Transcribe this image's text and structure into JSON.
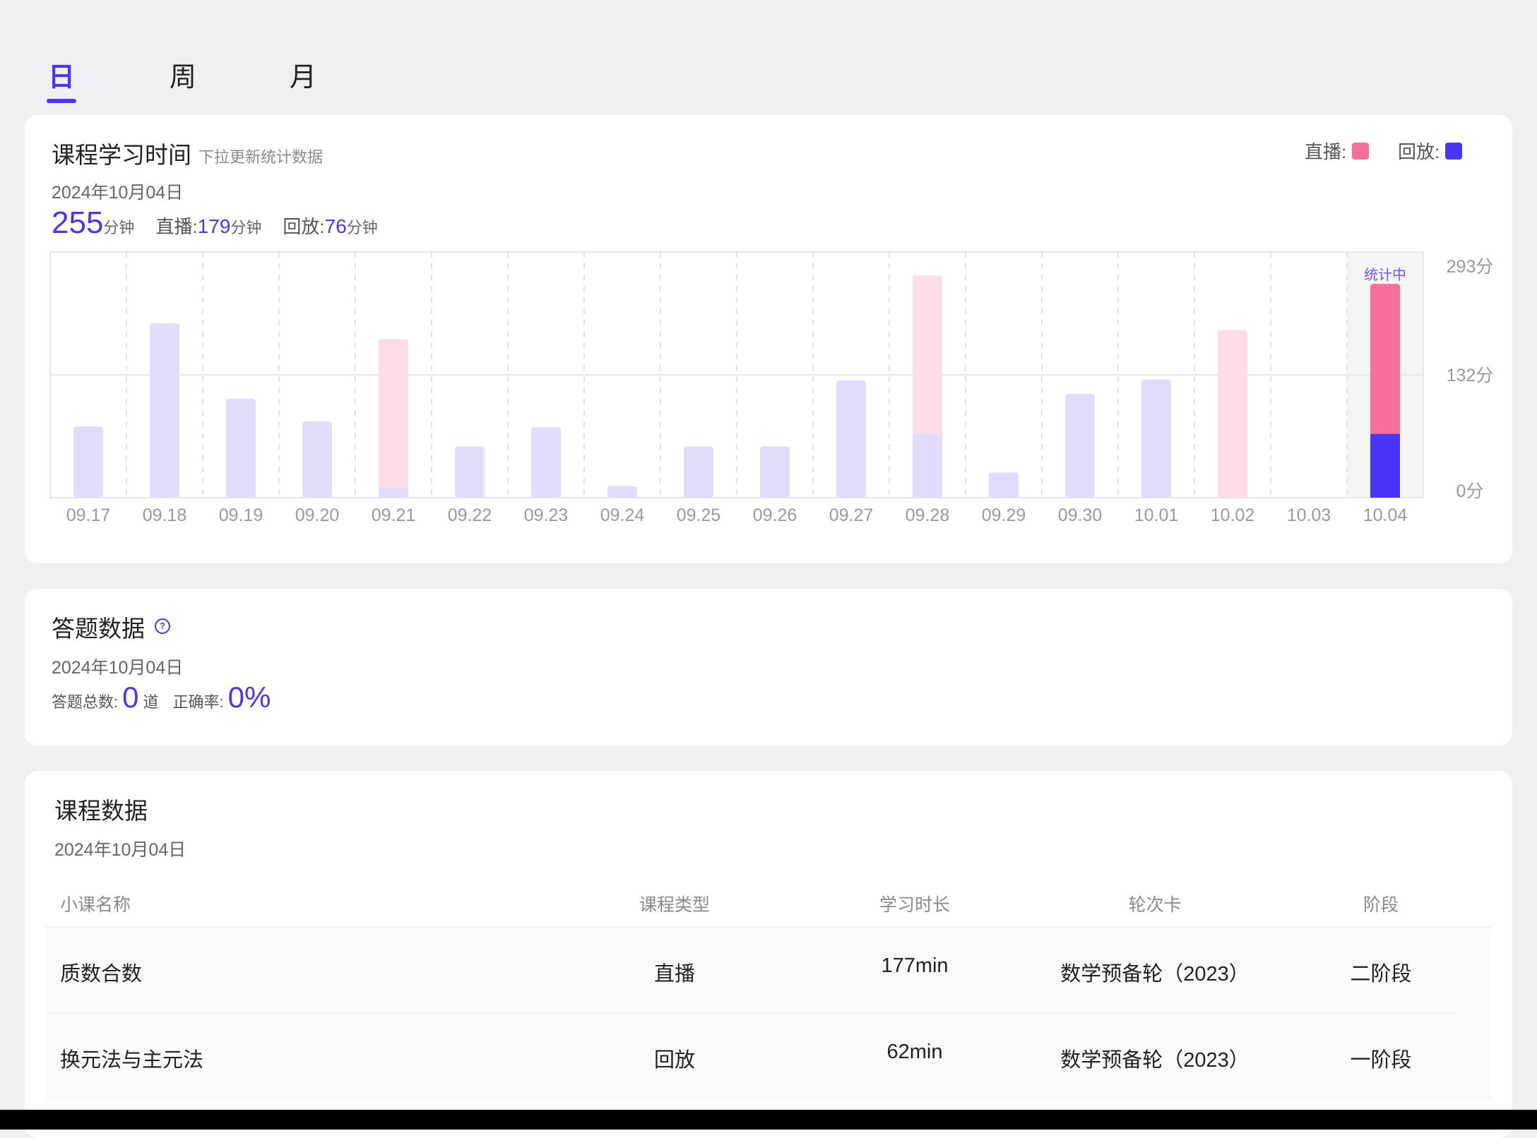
{
  "tabs": [
    {
      "label": "日",
      "active": true
    },
    {
      "label": "周",
      "active": false
    },
    {
      "label": "月",
      "active": false
    }
  ],
  "study_time": {
    "title": "课程学习时间",
    "hint": "下拉更新统计数据",
    "legend": {
      "live_label": "直播:",
      "replay_label": "回放:"
    },
    "date": "2024年10月04日",
    "total": "255",
    "total_unit": "分钟",
    "live_label": "直播:",
    "live_value": "179",
    "live_unit": "分钟",
    "replay_label": "回放:",
    "replay_value": "76",
    "replay_unit": "分钟"
  },
  "chart_data": {
    "type": "bar",
    "stacked": true,
    "categories": [
      "09.17",
      "09.18",
      "09.19",
      "09.20",
      "09.21",
      "09.22",
      "09.23",
      "09.24",
      "09.25",
      "09.26",
      "09.27",
      "09.28",
      "09.29",
      "09.30",
      "10.01",
      "10.02",
      "10.03",
      "10.04"
    ],
    "series": [
      {
        "name": "回放",
        "values": [
          85,
          208,
          118,
          91,
          12,
          61,
          84,
          14,
          61,
          61,
          140,
          75,
          30,
          124,
          141,
          0,
          0,
          76
        ]
      },
      {
        "name": "直播",
        "values": [
          0,
          0,
          0,
          0,
          177,
          0,
          0,
          0,
          0,
          0,
          0,
          190,
          0,
          0,
          0,
          200,
          0,
          179
        ]
      }
    ],
    "y_ticks": [
      "293分",
      "132分",
      "0分"
    ],
    "ylim": [
      0,
      293
    ],
    "highlight_category": "10.04",
    "highlight_label": "统计中",
    "grid": true,
    "colors": {
      "live": "#f57099",
      "replay": "#4a35f5",
      "live_faded": "#ffdde7",
      "replay_faded": "#e0dcfb",
      "highlight_bg": "#f5f5f6"
    }
  },
  "answers": {
    "title": "答题数据",
    "help_icon": "help-circle-icon",
    "help_glyph": "?",
    "date": "2024年10月04日",
    "total_label": "答题总数:",
    "total_value": "0",
    "total_unit": "道",
    "accuracy_label": "正确率:",
    "accuracy_value": "0%"
  },
  "courses": {
    "title": "课程数据",
    "date": "2024年10月04日",
    "columns": [
      "小课名称",
      "课程类型",
      "学习时长",
      "轮次卡",
      "阶段"
    ],
    "rows": [
      [
        "质数合数",
        "直播",
        "177min",
        "数学预备轮（2023）",
        "二阶段"
      ],
      [
        "换元法与主元法",
        "回放",
        "62min",
        "数学预备轮（2023）",
        "一阶段"
      ]
    ]
  }
}
